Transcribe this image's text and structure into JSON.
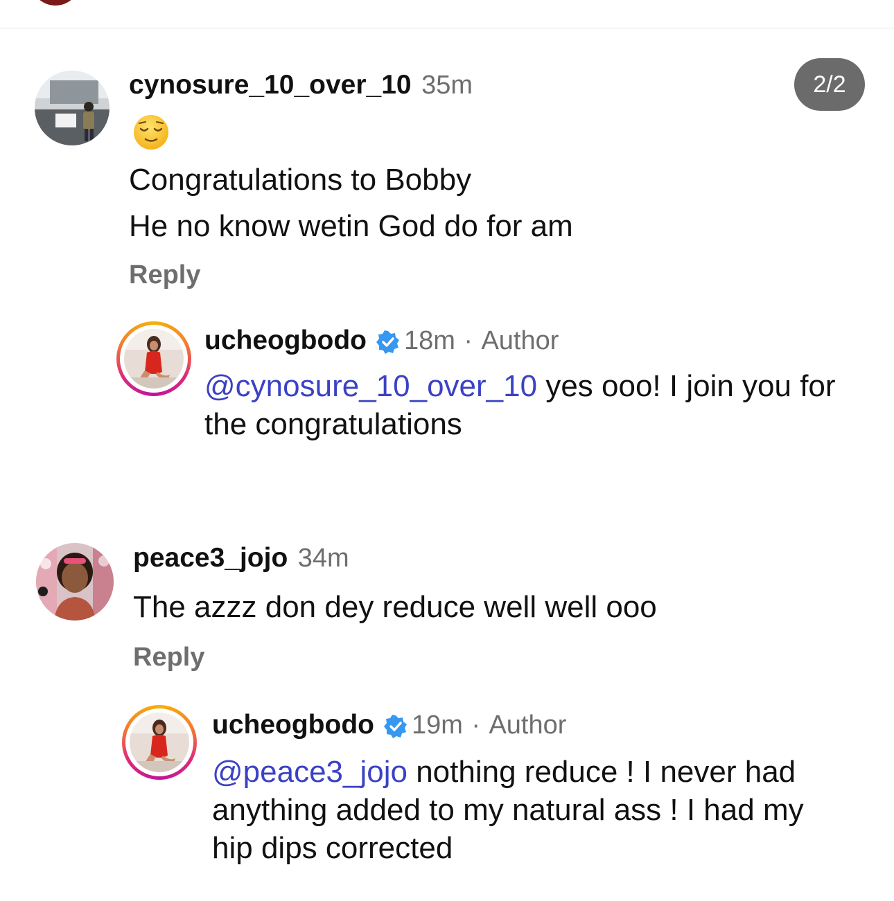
{
  "pager": {
    "label": "2/2"
  },
  "comments": [
    {
      "username": "cynosure_10_over_10",
      "time": "35m",
      "emoji_icon": "relieved-face-emoji",
      "lines": [
        "Congratulations to Bobby",
        "He no know wetin God do for am"
      ],
      "reply_label": "Reply",
      "reply": {
        "username": "ucheogbodo",
        "time": "18m",
        "separator": "·",
        "author_label": "Author",
        "mention": "@cynosure_10_over_10",
        "text": " yes ooo! I join you for the congratulations"
      }
    },
    {
      "username": "peace3_jojo",
      "time": "34m",
      "lines": [
        "The azzz don dey reduce well well ooo"
      ],
      "reply_label": "Reply",
      "reply": {
        "username": "ucheogbodo",
        "time": "19m",
        "separator": "·",
        "author_label": "Author",
        "mention": "@peace3_jojo",
        "text": " nothing reduce ! I never had anything added to my natural ass ! I had my hip dips corrected"
      }
    }
  ],
  "colors": {
    "mention": "#3b42c4",
    "verified": "#3897f0",
    "muted": "#6e6e6e",
    "pager_bg": "#6b6b6b",
    "story_ring_start": "#f6b20a",
    "story_ring_end": "#c0139a"
  }
}
